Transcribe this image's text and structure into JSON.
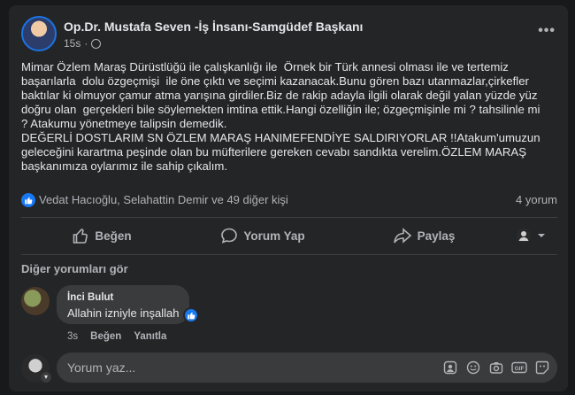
{
  "post": {
    "author": "Op.Dr. Mustafa Seven -İş İnsanı-Samgüdef Başkanı",
    "time": "15s",
    "more_label": "•••",
    "body": "Mimar Özlem Maraş Dürüstlüğü ile çalışkanlığı ile  Örnek bir Türk annesi olması ile ve tertemiz\nbaşarılarla  dolu özgeçmişi  ile öne çıktı ve seçimi kazanacak.Bunu gören bazı utanmazlar,çirkefler\nbaktılar ki olmuyor çamur atma yarışına girdiler.Biz de rakip adayla ilgili olarak değil yalan yüzde yüz\ndoğru olan  gerçekleri bile söylemekten imtina ettik.Hangi özelliğin ile; özgeçmişinle mi ? tahsilinle mi\n? Atakumu yönetmeye talipsin demedik.\nDEĞERLİ DOSTLARIM SN ÖZLEM MARAŞ HANIMEFENDİYE SALDIRIYORLAR !!Atakum'umuzun\ngeleceğini karartma peşinde olan bu müfterilere gereken cevabı sandıkta verelim.ÖZLEM MARAŞ\nbaşkanımıza oylarımız ile sahip çıkalım."
  },
  "reactions": {
    "summary": "Vedat Hacıoğlu, Selahattin Demir ve 49 diğer kişi",
    "comments_count": "4 yorum"
  },
  "actions": {
    "like": "Beğen",
    "comment": "Yorum Yap",
    "share": "Paylaş"
  },
  "comments_section": {
    "view_more": "Diğer yorumları gör",
    "items": [
      {
        "author": "İnci Bulut",
        "text": "Allahin izniyle inşallah",
        "time": "3s",
        "like_label": "Beğen",
        "reply_label": "Yanıtla"
      }
    ]
  },
  "composer": {
    "placeholder": "Yorum yaz..."
  },
  "colors": {
    "accent": "#1877f2",
    "card": "#242526",
    "background": "#18191a"
  }
}
